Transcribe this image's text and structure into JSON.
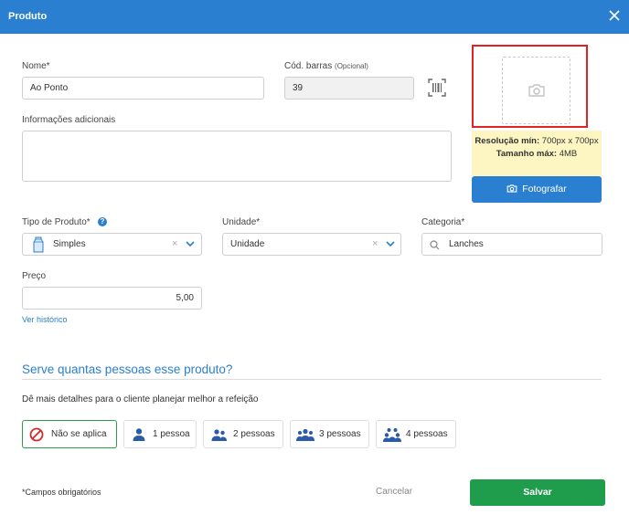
{
  "header": {
    "title": "Produto"
  },
  "form": {
    "nome_label": "Nome*",
    "nome_value": "Ao Ponto",
    "codbarras_label": "Cód. barras",
    "codbarras_optional": "(Opcional)",
    "codbarras_value": "39",
    "info_label": "Informações adicionais",
    "info_value": "",
    "tipo_label": "Tipo de Produto*",
    "tipo_value": "Simples",
    "unidade_label": "Unidade*",
    "unidade_value": "Unidade",
    "categoria_label": "Categoria*",
    "categoria_value": "Lanches",
    "preco_label": "Preço",
    "preco_value": "5,00",
    "historico_link": "Ver histórico"
  },
  "photo": {
    "res_bold": "Resolução mín:",
    "res_value": "700px x 700px",
    "size_bold": "Tamanho máx:",
    "size_value": "4MB",
    "button_label": "Fotografar"
  },
  "servings": {
    "title": "Serve quantas pessoas esse produto?",
    "subtitle": "Dê mais detalhes para o cliente planejar melhor a refeição",
    "options": [
      {
        "label": "Não se aplica",
        "icon": "no-entry-icon",
        "active": true
      },
      {
        "label": "1 pessoa",
        "icon": "person-icon"
      },
      {
        "label": "2 pessoas",
        "icon": "two-people-icon"
      },
      {
        "label": "3 pessoas",
        "icon": "three-people-icon"
      },
      {
        "label": "4 pessoas",
        "icon": "four-people-icon"
      }
    ]
  },
  "footer": {
    "required_note": "*Campos obrigatórios",
    "cancel_label": "Cancelar",
    "save_label": "Salvar"
  },
  "colors": {
    "primary": "#2a7fd0",
    "save": "#1f9d4c",
    "highlight": "#e02222",
    "info_bg": "#fdf6c2"
  }
}
